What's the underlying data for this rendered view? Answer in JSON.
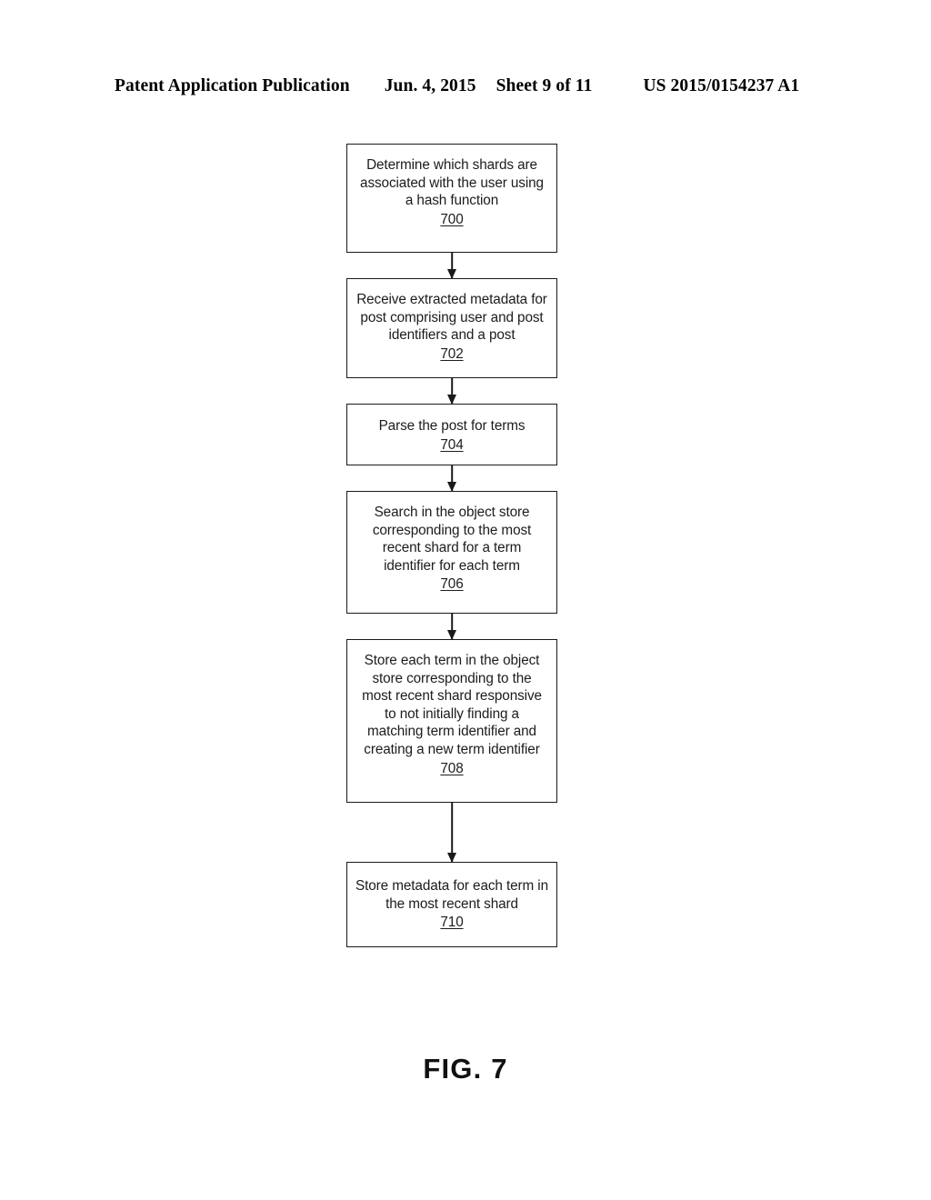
{
  "header": {
    "publication": "Patent Application Publication",
    "date": "Jun. 4, 2015",
    "sheet": "Sheet 9 of 11",
    "patent_number": "US 2015/0154237 A1"
  },
  "figure": {
    "caption": "FIG. 7"
  },
  "flowchart": {
    "nodes": [
      {
        "id": "700",
        "text": "Determine which shards are associated with the user using a hash function",
        "ref": "700"
      },
      {
        "id": "702",
        "text": "Receive extracted metadata for post comprising user and post identifiers and a post",
        "ref": "702"
      },
      {
        "id": "704",
        "text": "Parse the post for terms",
        "ref": "704"
      },
      {
        "id": "706",
        "text": "Search in the object store corresponding to the most recent shard for a term identifier for each term",
        "ref": "706"
      },
      {
        "id": "708",
        "text": "Store each term in the object store corresponding to the most recent shard responsive to not initially finding a matching term identifier and creating a new term identifier",
        "ref": "708"
      },
      {
        "id": "710",
        "text": "Store metadata for each term in the most recent shard",
        "ref": "710"
      }
    ]
  }
}
